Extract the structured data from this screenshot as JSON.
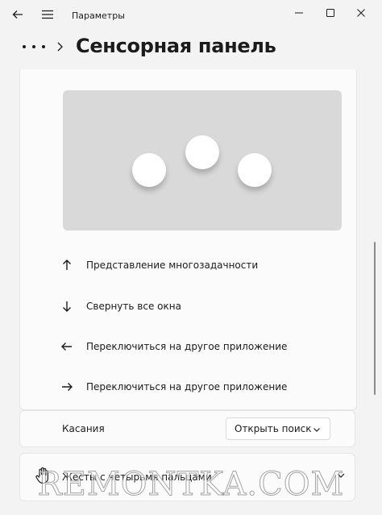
{
  "titlebar": {
    "back_icon": "arrow-left-icon",
    "menu_icon": "hamburger-icon",
    "app_title": "Параметры",
    "minimize_icon": "minimize-icon",
    "maximize_icon": "maximize-icon",
    "close_icon": "close-icon"
  },
  "header": {
    "more_icon": "more-horizontal-icon",
    "chevron_icon": "chevron-right-icon",
    "page_title": "Сенсорная панель"
  },
  "gestures": [
    {
      "icon": "arrow-up-icon",
      "label": "Представление многозадачности"
    },
    {
      "icon": "arrow-down-icon",
      "label": "Свернуть все окна"
    },
    {
      "icon": "arrow-left-icon",
      "label": "Переключиться на другое приложение"
    },
    {
      "icon": "arrow-right-icon",
      "label": "Переключиться на другое приложение"
    }
  ],
  "taps": {
    "label": "Касания",
    "dropdown_value": "Открыть поиск"
  },
  "four_finger": {
    "icon": "hand-icon",
    "label": "Жесты с четырьмя пальцами"
  },
  "watermark": "REMONTKA.COM",
  "colors": {
    "background": "#f3f3f3",
    "card": "#fbfbfb",
    "preview": "#d9d9d9"
  }
}
